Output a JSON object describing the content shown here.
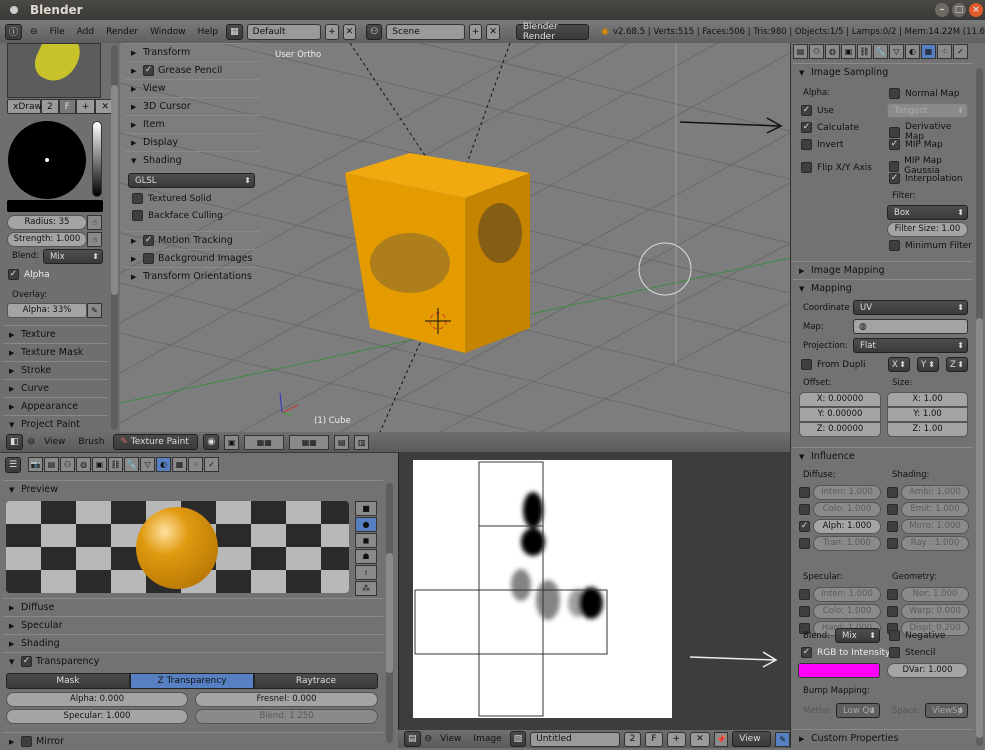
{
  "window": {
    "title": "Blender"
  },
  "info": {
    "menus": [
      "File",
      "Add",
      "Render",
      "Window",
      "Help"
    ],
    "screen": "Default",
    "scene": "Scene",
    "engine": "Blender Render",
    "stats": "v2.68.5 | Verts:515 | Faces:506 | Tris:980 | Objects:1/5 | Lamps:0/2 | Mem:14.22M (11.6"
  },
  "toolshelf": {
    "brush_name": "xDraw",
    "brush_users": "2",
    "fake_user": "F",
    "radius": "Radius: 35",
    "strength": "Strength: 1.000",
    "blend_label": "Blend:",
    "blend": "Mix",
    "alpha_label": "Alpha",
    "overlay_label": "Overlay:",
    "overlay_alpha": "Alpha: 33%",
    "alpha_checked": true,
    "panels": [
      "Texture",
      "Texture Mask",
      "Stroke",
      "Curve",
      "Appearance",
      "Project Paint"
    ]
  },
  "npanel": {
    "panels": [
      "Transform",
      "Grease Pencil",
      "View",
      "3D Cursor",
      "Item",
      "Display",
      "Shading"
    ],
    "shading_mode": "GLSL",
    "textured_solid": "Textured Solid",
    "backface_culling": "Backface Culling",
    "panels2": [
      "Motion Tracking",
      "Background Images",
      "Transform Orientations"
    ]
  },
  "viewport": {
    "label": "User Ortho",
    "object": "(1) Cube",
    "colors": {
      "cube": "#e39b00",
      "bg": "#7d7d7d"
    }
  },
  "viewport_header": {
    "view": "View",
    "brush": "Brush",
    "mode": "Texture Paint"
  },
  "material": {
    "preview": "Preview",
    "panels": [
      "Diffuse",
      "Specular",
      "Shading"
    ],
    "transparency": "Transparency",
    "tabs": [
      "Mask",
      "Z Transparency",
      "Raytrace"
    ],
    "active_tab": "Z Transparency",
    "alpha": "Alpha: 0.000",
    "fresnel": "Fresnel: 0.000",
    "specular": "Specular: 1.000",
    "blend": "Blend: 1.250",
    "next": "Mirror"
  },
  "image_editor": {
    "view": "View",
    "image": "Image",
    "image_name": "Untitled",
    "users": "2",
    "fake": "F",
    "view_mode": "View"
  },
  "texture": {
    "image_sampling": "Image Sampling",
    "alpha_label": "Alpha:",
    "use": "Use",
    "calculate": "Calculate",
    "invert": "Invert",
    "flip": "Flip X/Y Axis",
    "normal_map": "Normal Map",
    "tangent": "Tangent",
    "derivative_map": "Derivative Map",
    "mip_map": "MIP Map",
    "mip_gauss": "MIP Map Gaussia",
    "interpolation": "Interpolation",
    "filter_label": "Filter:",
    "filter": "Box",
    "filter_size": "Filter Size: 1.00",
    "min_filter": "Minimum Filter",
    "image_mapping": "Image Mapping",
    "mapping": "Mapping",
    "coordinate_label": "Coordinate",
    "coordinate": "UV",
    "map_label": "Map:",
    "projection_label": "Projection:",
    "projection": "Flat",
    "from_dupli": "From Dupli",
    "axes": [
      "X",
      "Y",
      "Z"
    ],
    "offset_label": "Offset:",
    "offset": [
      "X: 0.00000",
      "Y: 0.00000",
      "Z: 0.00000"
    ],
    "size_label": "Size:",
    "size": [
      "X: 1.00",
      "Y: 1.00",
      "Z: 1.00"
    ],
    "influence": "Influence",
    "diffuse_label": "Diffuse:",
    "diffuse": [
      "Inten: 1.000",
      "Colo: 1.000",
      "Alph: 1.000",
      "Tran: 1.000"
    ],
    "shading_label": "Shading:",
    "shading": [
      "Ambi: 1.000",
      "Emit: 1.000",
      "Mirro: 1.000",
      "Ray : 1.000"
    ],
    "specular_label": "Specular:",
    "specular": [
      "Inten: 1.000",
      "Colo: 1.000",
      "Hard: 1.000"
    ],
    "geometry_label": "Geometry:",
    "geometry": [
      "Nor: 1.000",
      "Warp: 0.000",
      "Displ: 0.200"
    ],
    "blend_label": "Blend:",
    "blend": "Mix",
    "negative": "Negative",
    "rgb_to_intensity": "RGB to Intensity",
    "stencil": "Stencil",
    "dvar": "DVar: 1.000",
    "color": "#ff00ff",
    "bump_label": "Bump Mapping:",
    "method_label": "Metho",
    "method": "Low Qu",
    "space_label": "Space:",
    "space": "ViewSp",
    "custom_props": "Custom Properties"
  }
}
